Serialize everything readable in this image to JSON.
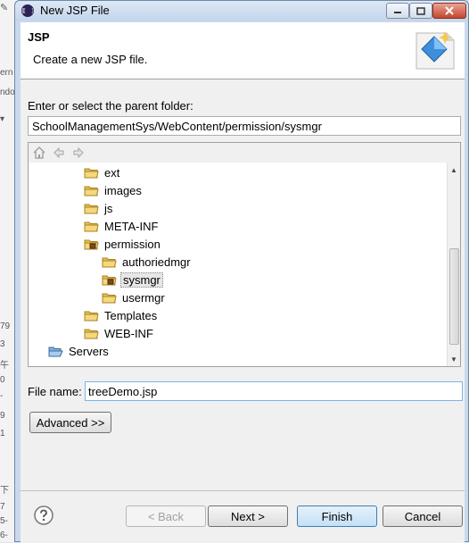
{
  "window": {
    "title": "New JSP File"
  },
  "header": {
    "title": "JSP",
    "description": "Create a new JSP file."
  },
  "parent_folder": {
    "label": "Enter or select the parent folder:",
    "value": "SchoolManagementSys/WebContent/permission/sysmgr"
  },
  "tree": {
    "items": [
      {
        "label": "ext"
      },
      {
        "label": "images"
      },
      {
        "label": "js"
      },
      {
        "label": "META-INF"
      },
      {
        "label": "permission"
      },
      {
        "label": "authoriedmgr"
      },
      {
        "label": "sysmgr"
      },
      {
        "label": "usermgr"
      },
      {
        "label": "Templates"
      },
      {
        "label": "WEB-INF"
      },
      {
        "label": "Servers"
      }
    ],
    "selected": "sysmgr"
  },
  "file_name": {
    "label": "File name:",
    "value": "treeDemo.jsp"
  },
  "buttons": {
    "advanced": "Advanced >>",
    "back": "< Back",
    "next": "Next >",
    "finish": "Finish",
    "cancel": "Cancel"
  },
  "icons": {
    "home": "home-icon",
    "back": "back-arrow-icon",
    "forward": "forward-arrow-icon",
    "help": "help-icon",
    "wizard": "jsp-wizard-banner-icon"
  },
  "colors": {
    "title_bar": "#c4d6ec",
    "close_button": "#c7462e",
    "folder": "#e8c25a",
    "finish_border": "#3c7fb1"
  }
}
